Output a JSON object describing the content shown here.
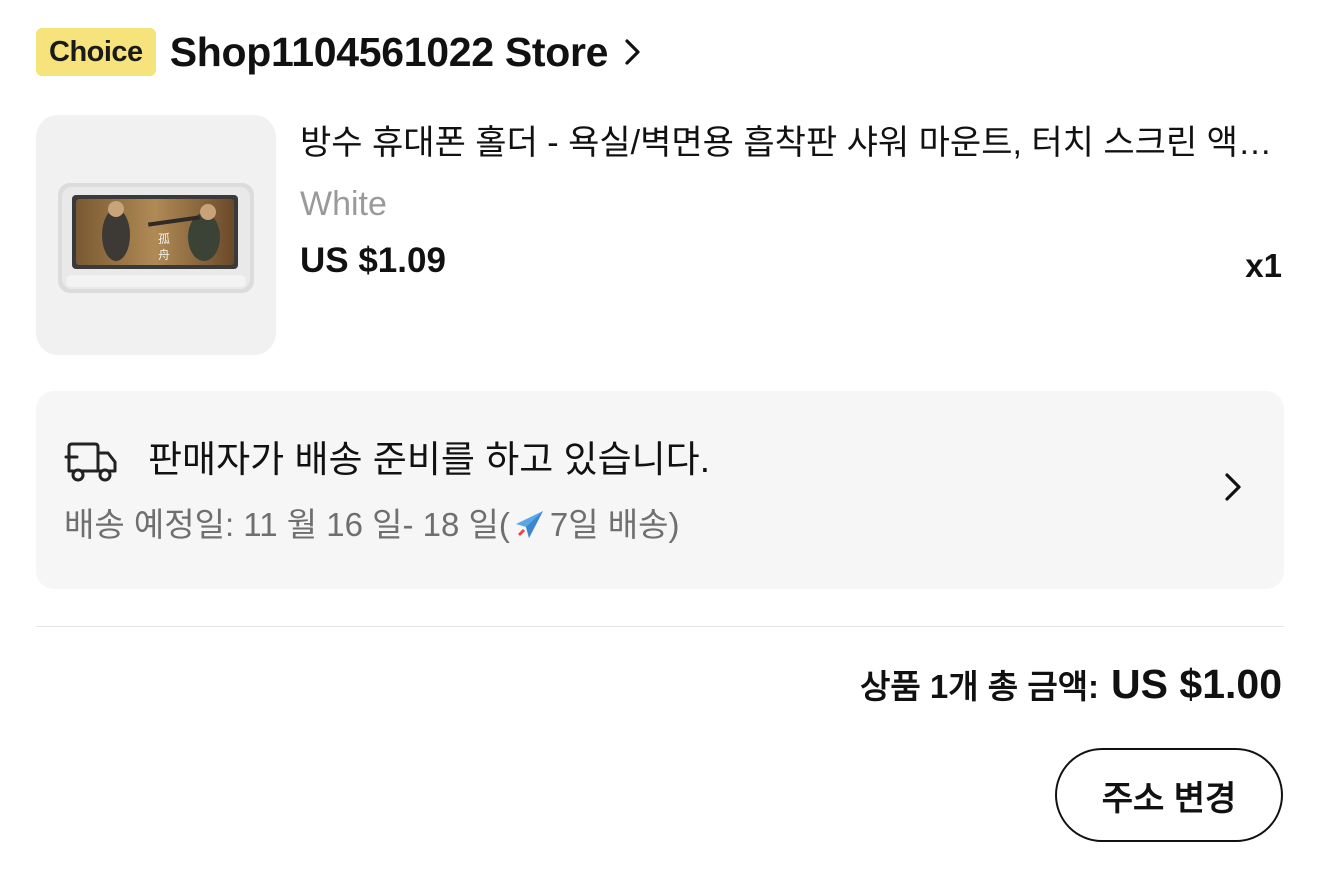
{
  "store": {
    "badge": "Choice",
    "name": "Shop1104561022 Store",
    "badge_color": "#f7e37c"
  },
  "product": {
    "title": "방수 휴대폰 홀더 - 욕실/벽면용 흡착판 샤워 마운트, 터치 스크린 액…",
    "variant": "White",
    "price": "US $1.09",
    "quantity": "x1",
    "image": "product-image"
  },
  "shipping": {
    "status": "판매자가 배송 준비를 하고 있습니다.",
    "eta_prefix": "배송 예정일: 11 월 16 일- 18 일(",
    "eta_suffix": "7일 배송)",
    "icons": [
      "truck-icon",
      "airplane-icon",
      "chevron-right-icon"
    ]
  },
  "summary": {
    "total_label": "상품 1개 총 금액:",
    "total_amount": "US $1.00"
  },
  "actions": {
    "change_address": "주소 변경"
  }
}
